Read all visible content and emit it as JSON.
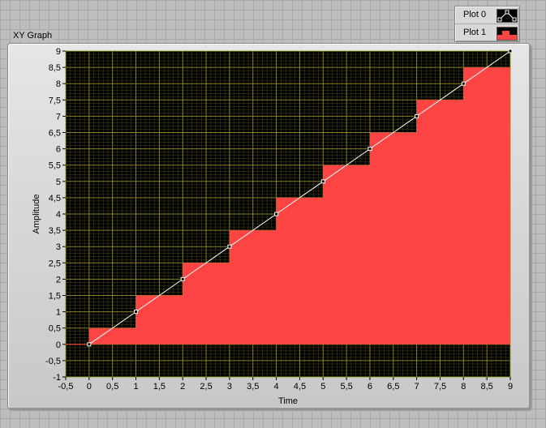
{
  "graph": {
    "label": "XY Graph"
  },
  "legend": {
    "items": [
      {
        "name": "Plot 0",
        "style": "line-with-points"
      },
      {
        "name": "Plot 1",
        "style": "step-fill"
      }
    ]
  },
  "colors": {
    "plot_bg": "#000000",
    "grid": "#9a9a20",
    "zero_line": "#ff4444",
    "plot0": "#ffffff",
    "plot1_fill": "#ff4444"
  },
  "chart_data": {
    "type": "line",
    "title": "",
    "xlabel": "Time",
    "ylabel": "Amplitude",
    "xlim": [
      -0.5,
      9
    ],
    "ylim": [
      -1,
      9
    ],
    "x_ticks": [
      "-0,5",
      "0",
      "0,5",
      "1",
      "1,5",
      "2",
      "2,5",
      "3",
      "3,5",
      "4",
      "4,5",
      "5",
      "5,5",
      "6",
      "6,5",
      "7",
      "7,5",
      "8",
      "8,5",
      "9"
    ],
    "y_ticks": [
      "-1",
      "-0,5",
      "0",
      "0,5",
      "1",
      "1,5",
      "2",
      "2,5",
      "3",
      "3,5",
      "4",
      "4,5",
      "5",
      "5,5",
      "6",
      "6,5",
      "7",
      "7,5",
      "8",
      "8,5",
      "9"
    ],
    "grid": true,
    "legend_position": "top-right",
    "series": [
      {
        "name": "Plot 0",
        "style": "line-with-points",
        "x": [
          0,
          1,
          2,
          3,
          4,
          5,
          6,
          7,
          8,
          9
        ],
        "y": [
          0,
          1,
          2,
          3,
          4,
          5,
          6,
          7,
          8,
          9
        ]
      },
      {
        "name": "Plot 1",
        "style": "step-fill",
        "x": [
          0,
          1,
          2,
          3,
          4,
          5,
          6,
          7,
          8,
          9
        ],
        "y": [
          0.5,
          1.5,
          2.5,
          3.5,
          4.5,
          5.5,
          6.5,
          7.5,
          8.5,
          8.5
        ]
      }
    ]
  }
}
